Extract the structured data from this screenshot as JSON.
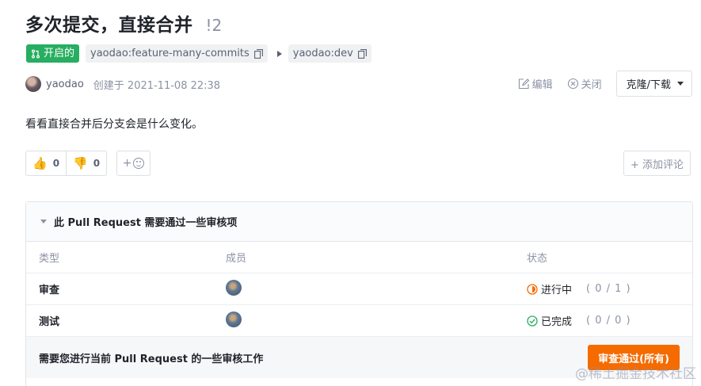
{
  "header": {
    "title": "多次提交，直接合并",
    "pr_number": "!2"
  },
  "meta": {
    "state_label": "开启的",
    "source_branch": "yaodao:feature-many-commits",
    "target_branch": "yaodao:dev",
    "colors": {
      "state": "#27ae60",
      "accent": "#f56b00"
    }
  },
  "author": {
    "name": "yaodao",
    "created_at": "创建于 2021-11-08 22:38"
  },
  "actions": {
    "edit_label": "编辑",
    "close_label": "关闭",
    "clone_label": "克隆/下载"
  },
  "description": "看看直接合并后分支会是什么变化。",
  "reactions": {
    "thumbs_up_count": "0",
    "thumbs_down_count": "0",
    "add_reaction_label": "+",
    "add_comment_label": "+ 添加评论"
  },
  "review": {
    "title": "此 Pull Request 需要通过一些审核项",
    "columns": [
      "类型",
      "成员",
      "状态"
    ],
    "rows": [
      {
        "type": "审查",
        "status": "进行中",
        "count": "( 0 / 1 )",
        "icon": "in-progress-icon"
      },
      {
        "type": "测试",
        "status": "已完成",
        "count": "( 0 / 0 )",
        "icon": "check-circle-icon"
      }
    ],
    "footer_text": "需要您进行当前 Pull Request 的一些审核工作",
    "approve_label": "审查通过(所有)"
  },
  "watermark": "@稀土掘金技术社区"
}
